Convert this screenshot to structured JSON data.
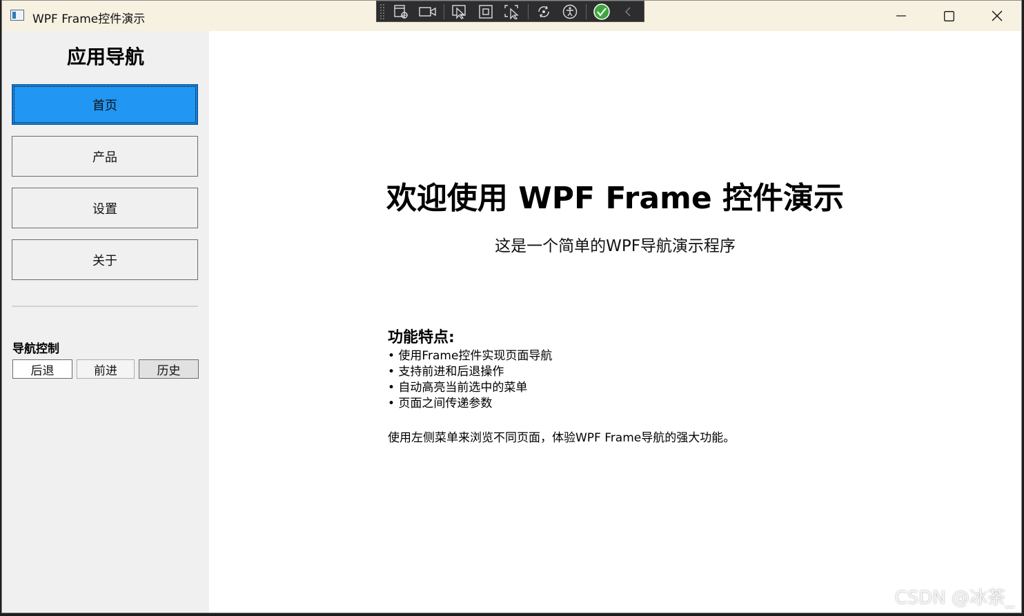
{
  "window": {
    "title": "WPF Frame控件演示"
  },
  "debug_toolbar": {
    "icons": [
      "live-visual-tree-icon",
      "record-icon",
      "select-element-icon",
      "display-layout-adorners-icon",
      "track-focus-icon",
      "hot-reload-icon",
      "accessibility-icon",
      "checkmark-icon",
      "collapse-icon"
    ]
  },
  "sidebar": {
    "title": "应用导航",
    "nav_items": [
      {
        "label": "首页",
        "active": true
      },
      {
        "label": "产品",
        "active": false
      },
      {
        "label": "设置",
        "active": false
      },
      {
        "label": "关于",
        "active": false
      }
    ],
    "nav_control_label": "导航控制",
    "back_label": "后退",
    "forward_label": "前进",
    "history_label": "历史"
  },
  "content": {
    "headline": "欢迎使用 WPF Frame 控件演示",
    "subline": "这是一个简单的WPF导航演示程序",
    "features_title": "功能特点:",
    "features": [
      "• 使用Frame控件实现页面导航",
      "• 支持前进和后退操作",
      "• 自动高亮当前选中的菜单",
      "• 页面之间传递参数"
    ],
    "note": "使用左侧菜单来浏览不同页面，体验WPF Frame导航的强大功能。"
  },
  "watermark": "CSDN @冰茶_",
  "colors": {
    "active_nav": "#2196f3",
    "titlebar": "#f7f1e1",
    "sidebar_bg": "#f0f0f0"
  }
}
